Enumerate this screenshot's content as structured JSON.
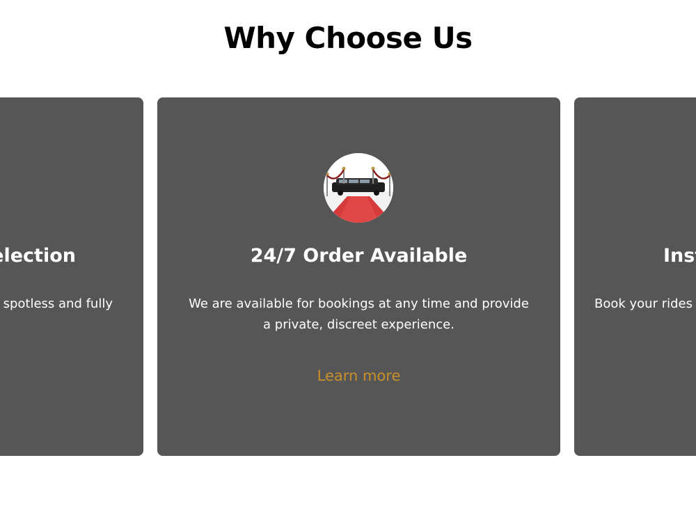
{
  "section": {
    "title": "Why Choose Us"
  },
  "cards": [
    {
      "heading": "election",
      "text": "e spotless and fully"
    },
    {
      "heading": "24/7 Order Available",
      "text": "We are available for bookings at any time and provide a private, discreet experience.",
      "link": "Learn more",
      "icon": "limousine-red-carpet-icon"
    },
    {
      "heading": "Inst",
      "text": "Book your rides"
    }
  ],
  "colors": {
    "card_background": "#565656",
    "link": "#c8902a",
    "title": "#000000",
    "card_text": "#ffffff"
  }
}
